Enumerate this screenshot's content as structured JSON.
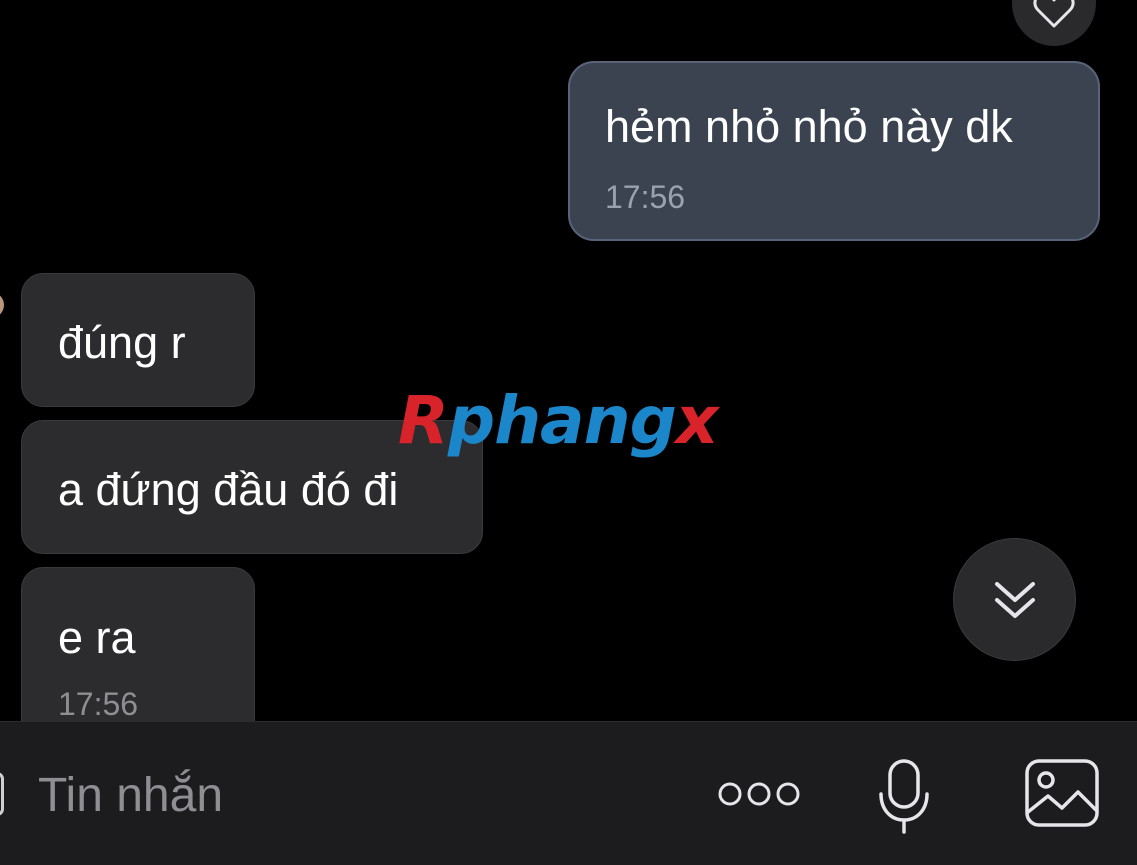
{
  "messages": [
    {
      "direction": "outgoing",
      "text": "hẻm nhỏ nhỏ này dk",
      "time": "17:56"
    },
    {
      "direction": "incoming",
      "text": "đúng r"
    },
    {
      "direction": "incoming",
      "text": "a đứng đầu đó đi"
    },
    {
      "direction": "incoming",
      "text": "e ra",
      "time": "17:56"
    }
  ],
  "watermark": {
    "first": "R",
    "middle": "phang",
    "last": "x"
  },
  "composer": {
    "placeholder": "Tin nhắn"
  },
  "icons": {
    "react": "heart-icon",
    "scroll": "double-chevron-down-icon",
    "more": "more-dots-icon",
    "mic": "microphone-icon",
    "image": "image-icon"
  },
  "colors": {
    "outgoing_bubble": "#3b4351",
    "incoming_bubble": "#2c2c2e",
    "watermark_red": "#d9232b",
    "watermark_blue": "#1b86c9"
  }
}
